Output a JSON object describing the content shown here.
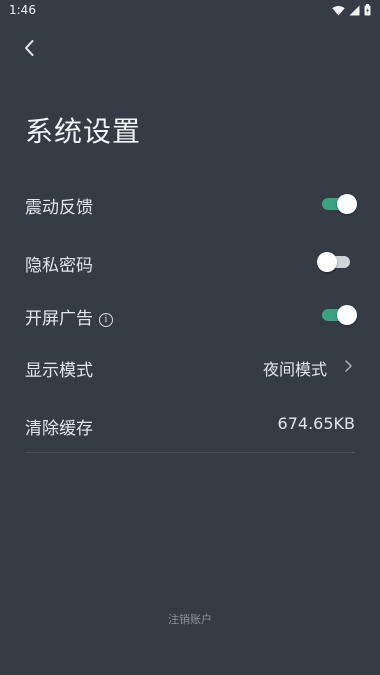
{
  "status_bar": {
    "time": "1:46"
  },
  "header": {
    "title": "系统设置"
  },
  "settings": {
    "vibration": {
      "label": "震动反馈",
      "enabled": true
    },
    "privacy_lock": {
      "label": "隐私密码",
      "enabled": false
    },
    "splash_ad": {
      "label": "开屏广告",
      "enabled": true,
      "info_glyph": "i"
    },
    "display_mode": {
      "label": "显示模式",
      "value": "夜间模式"
    },
    "clear_cache": {
      "label": "清除缓存",
      "value": "674.65KB"
    }
  },
  "footer": {
    "logout_label": "注销账户"
  },
  "colors": {
    "background": "#353c45",
    "toggle_on": "#3ba17f",
    "toggle_off": "#cfd4d9"
  }
}
